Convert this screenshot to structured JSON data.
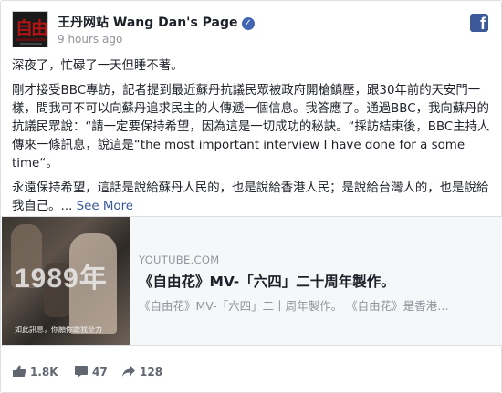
{
  "header": {
    "page_name": "王丹网站 Wang Dan's Page",
    "verified_mark": "✓",
    "timestamp": "9 hours ago",
    "avatar_text": "自由",
    "facebook_icon_letter": "f"
  },
  "post": {
    "paragraphs": [
      "深夜了，忙碌了一天但睡不著。",
      "剛才接受BBC專訪，記者提到最近蘇丹抗議民眾被政府開槍鎮壓，跟30年前的天安門一樣，問我可不可以向蘇丹追求民主的人傳遞一個信息。我答應了。通過BBC，我向蘇丹的抗議民眾說：“請一定要保持希望，因為這是一切成功的秘訣。“採訪結束後，BBC主持人傳來一條訊息，說這是“the most important interview I have done for a some time“。",
      "永遠保持希望，這話是說給蘇丹人民的，也是說給香港人民；是說給台灣人的，也是說給我自己。..."
    ],
    "see_more": "See More"
  },
  "link_card": {
    "thumbnail_text": "1989年",
    "thumbnail_caption": "如此訊息，你願你跟我全力",
    "domain": "YOUTUBE.COM",
    "title": "《自由花》MV-「六四」二十周年製作。",
    "description": "《自由花》MV-「六四」二十周年製作。 《自由花》是香港…"
  },
  "actions": {
    "likes": "1.8K",
    "comments": "47",
    "shares": "128"
  },
  "colors": {
    "link_blue": "#365899",
    "facebook_blue": "#3b5998",
    "verified_blue": "#4267b2",
    "meta_gray": "#90949c"
  },
  "icons": {
    "verified": "verified-badge-icon",
    "facebook": "facebook-logo-icon",
    "like": "thumbs-up-icon",
    "comment": "comment-bubble-icon",
    "share": "share-arrow-icon"
  }
}
